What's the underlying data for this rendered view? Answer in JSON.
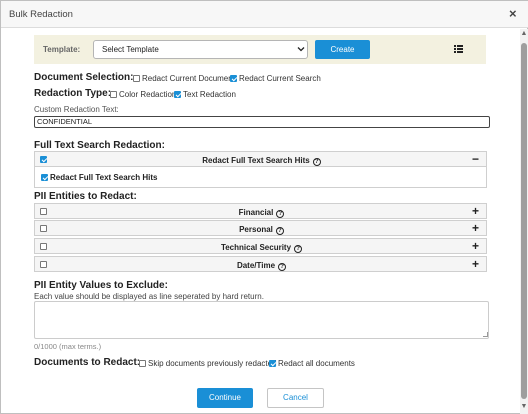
{
  "dialog": {
    "title": "Bulk Redaction",
    "close_label": "×"
  },
  "template": {
    "label": "Template:",
    "select_value": "Select Template",
    "create_label": "Create"
  },
  "document_selection": {
    "title": "Document Selection:",
    "options": [
      {
        "label": "Redact Current Document",
        "checked": false
      },
      {
        "label": "Redact Current Search",
        "checked": true
      }
    ]
  },
  "redaction_type": {
    "title": "Redaction Type:",
    "options": [
      {
        "label": "Color Redaction",
        "checked": false
      },
      {
        "label": "Text Redaction",
        "checked": true
      }
    ]
  },
  "custom_text": {
    "label": "Custom Redaction Text:",
    "value": "CONFIDENTIAL"
  },
  "full_text": {
    "title": "Full Text Search Redaction:",
    "header_label": "Redact Full Text Search Hits",
    "header_checked": true,
    "expanded_sign": "−",
    "body_label": "Redact Full Text Search Hits",
    "body_checked": true
  },
  "pii": {
    "title": "PII Entities to Redact:",
    "entities": [
      {
        "label": "Financial",
        "checked": false,
        "sign": "+"
      },
      {
        "label": "Personal",
        "checked": false,
        "sign": "+"
      },
      {
        "label": "Technical Security",
        "checked": false,
        "sign": "+"
      },
      {
        "label": "Date/Time",
        "checked": false,
        "sign": "+"
      }
    ]
  },
  "exclude": {
    "title": "PII Entity Values to Exclude:",
    "hint": "Each value should be displayed as line seperated by hard return.",
    "value": "",
    "counter": "0/1000 (max terms.)"
  },
  "documents_to_redact": {
    "title": "Documents to Redact:",
    "options": [
      {
        "label": "Skip documents previously redacted",
        "checked": false
      },
      {
        "label": "Redact all documents",
        "checked": true
      }
    ]
  },
  "footer": {
    "continue_label": "Continue",
    "cancel_label": "Cancel"
  },
  "colors": {
    "accent": "#1a8fd6",
    "template_bar": "#f3f1e0"
  },
  "icons": {
    "close": "close-icon",
    "chevron": "chevron-down-icon",
    "grid": "grid-icon",
    "help": "question-circle-icon",
    "expand": "plus-icon",
    "collapse": "minus-icon"
  }
}
